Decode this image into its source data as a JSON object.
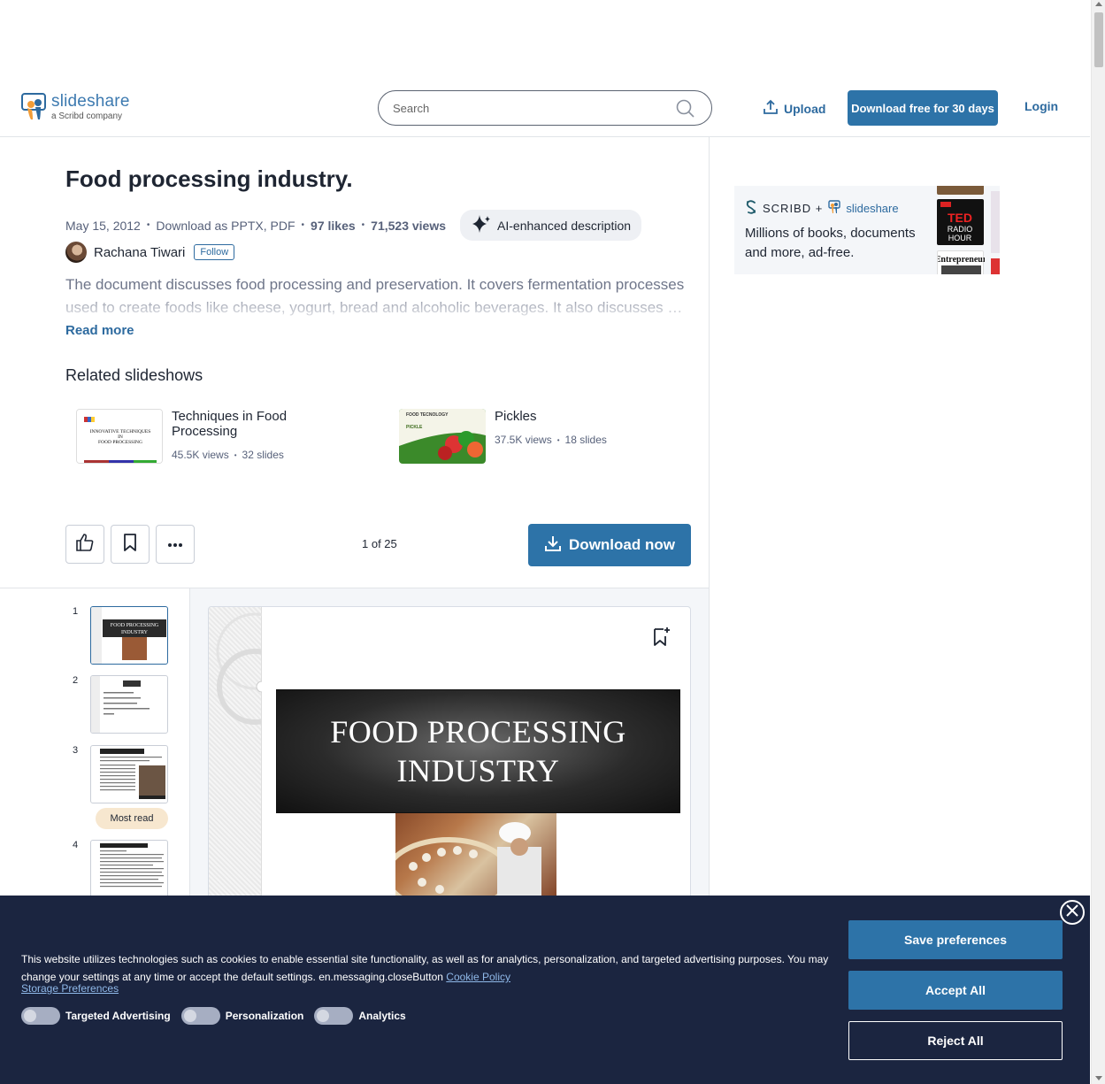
{
  "header": {
    "logo_brand": "slideshare",
    "logo_sub": "a Scribd company",
    "search_placeholder": "Search",
    "upload_label": "Upload",
    "cta_label": "Download free for 30 days",
    "login_label": "Login"
  },
  "doc": {
    "title": "Food processing industry.",
    "date": "May 15, 2012",
    "download_as": "Download as PPTX, PDF",
    "likes": "97 likes",
    "views": "71,523 views",
    "ai_label": "AI-enhanced description",
    "author": "Rachana Tiwari",
    "follow_label": "Follow",
    "description": "The document discusses food processing and preservation. It covers fermentation processes used to create foods like cheese, yogurt, bread and alcoholic beverages. It also discusses …",
    "read_more": "Read more"
  },
  "related": {
    "heading": "Related slideshows",
    "items": [
      {
        "title": "Techniques in Food Processing",
        "views": "45.5K views",
        "slides": "32 slides",
        "thumb_text": "INNOVATIVE TECHNIQUES IN FOOD PROCESSING"
      },
      {
        "title": "Pickles",
        "views": "37.5K views",
        "slides": "18 slides",
        "thumb_text": "FOOD TECNOLOGY PICKLE"
      }
    ]
  },
  "toolbar": {
    "page_counter": "1 of 25",
    "download_now": "Download now"
  },
  "viewer": {
    "thumb_numbers": [
      "1",
      "2",
      "3",
      "4"
    ],
    "most_read": "Most read",
    "slide_title_line1": "FOOD PROCESSING",
    "slide_title_line2": "INDUSTRY",
    "thumb1_text": "FOOD PROCESSING INDUSTRY"
  },
  "ad": {
    "brand_scribd": "SCRIBD +",
    "brand_slideshare": "slideshare",
    "text": "Millions of books, documents and more, ad-free.",
    "book_ted": "TED RADIO HOUR",
    "book_entrepreneur": "Entrepreneur"
  },
  "cookie": {
    "text": "This website utilizes technologies such as cookies to enable essential site functionality, as well as for analytics, personalization, and targeted advertising purposes. You may change your settings at any time or accept the default settings. en.messaging.closeButton",
    "policy_link": "Cookie Policy",
    "storage_link": "Storage Preferences",
    "toggles": [
      "Targeted Advertising",
      "Personalization",
      "Analytics"
    ],
    "save_label": "Save preferences",
    "accept_label": "Accept All",
    "reject_label": "Reject All"
  },
  "colors": {
    "brand_blue": "#2d73a8",
    "link_blue": "#2d6a9f",
    "cookie_bg": "#1b2540",
    "most_read_bg": "#f7e7cf"
  }
}
